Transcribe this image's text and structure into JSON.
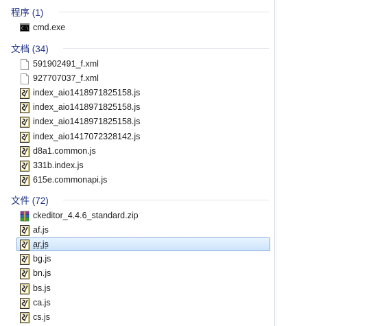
{
  "groups": [
    {
      "title": "程序 (1)",
      "items": [
        {
          "name": "cmd.exe",
          "icon": "cmd-exe-icon"
        }
      ]
    },
    {
      "title": "文档 (34)",
      "items": [
        {
          "name": "591902491_f.xml",
          "icon": "xml-file-icon"
        },
        {
          "name": "927707037_f.xml",
          "icon": "xml-file-icon"
        },
        {
          "name": "index_aio1418971825158.js",
          "icon": "js-file-icon"
        },
        {
          "name": "index_aio1418971825158.js",
          "icon": "js-file-icon"
        },
        {
          "name": "index_aio1418971825158.js",
          "icon": "js-file-icon"
        },
        {
          "name": "index_aio1417072328142.js",
          "icon": "js-file-icon"
        },
        {
          "name": "d8a1.common.js",
          "icon": "js-file-icon"
        },
        {
          "name": "331b.index.js",
          "icon": "js-file-icon"
        },
        {
          "name": "615e.commonapi.js",
          "icon": "js-file-icon"
        }
      ]
    },
    {
      "title": "文件 (72)",
      "items": [
        {
          "name": "ckeditor_4.4.6_standard.zip",
          "icon": "zip-archive-icon"
        },
        {
          "name": "af.js",
          "icon": "js-file-icon"
        },
        {
          "name": "ar.js",
          "icon": "js-file-icon",
          "selected": true
        },
        {
          "name": "bg.js",
          "icon": "js-file-icon"
        },
        {
          "name": "bn.js",
          "icon": "js-file-icon"
        },
        {
          "name": "bs.js",
          "icon": "js-file-icon"
        },
        {
          "name": "ca.js",
          "icon": "js-file-icon"
        },
        {
          "name": "cs.js",
          "icon": "js-file-icon"
        }
      ]
    }
  ],
  "colors": {
    "group_title": "#1e3287",
    "selection_border": "#84acdd",
    "selection_fill": "#cde4fb"
  }
}
